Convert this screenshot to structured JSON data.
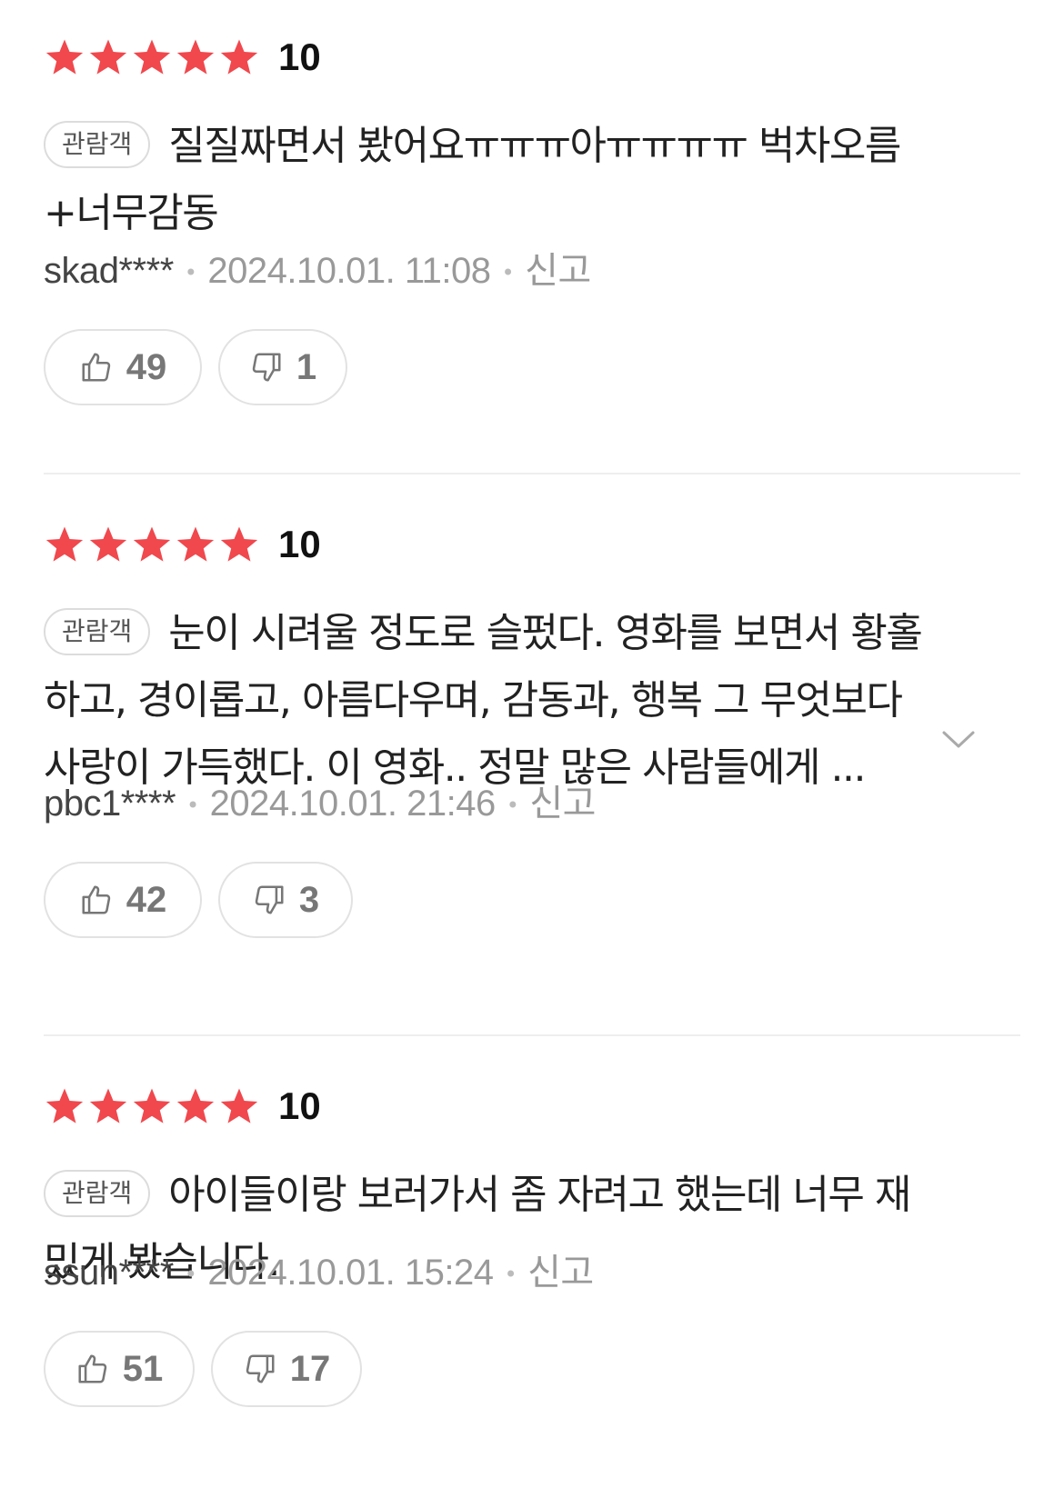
{
  "reviews": [
    {
      "score": "10",
      "stars_filled": 5,
      "badge": "관람객",
      "text_lines": [
        "질질짜면서 봤어요ㅠㅠㅠ아ㅠㅠㅠㅠ 벅차오름",
        "+너무감동"
      ],
      "user": "skad****",
      "date": "2024.10.01. 11:08",
      "report": "신고",
      "likes": "49",
      "dislikes": "1"
    },
    {
      "score": "10",
      "stars_filled": 5,
      "badge": "관람객",
      "text_lines": [
        "눈이 시려울 정도로 슬펐다. 영화를 보면서 황홀",
        "하고, 경이롭고, 아름다우며, 감동과, 행복 그 무엇보다",
        "사랑이 가득했다. 이 영화.. 정말 많은 사람들에게 ..."
      ],
      "user": "pbc1****",
      "date": "2024.10.01. 21:46",
      "report": "신고",
      "likes": "42",
      "dislikes": "3"
    },
    {
      "score": "10",
      "stars_filled": 5,
      "badge": "관람객",
      "text_lines": [
        "아이들이랑 보러가서 좀 자려고 했는데 너무 재",
        "밌게 봤습니다."
      ],
      "user": "ssun****",
      "date": "2024.10.01. 15:24",
      "report": "신고",
      "likes": "51",
      "dislikes": "17"
    }
  ],
  "colors": {
    "star": "#f0484d",
    "divider": "#eeeeee",
    "meta": "#999999"
  },
  "icons": {
    "like": "thumbs-up-icon",
    "dislike": "thumbs-down-icon",
    "expand": "chevron-down-icon",
    "star": "star-icon"
  }
}
